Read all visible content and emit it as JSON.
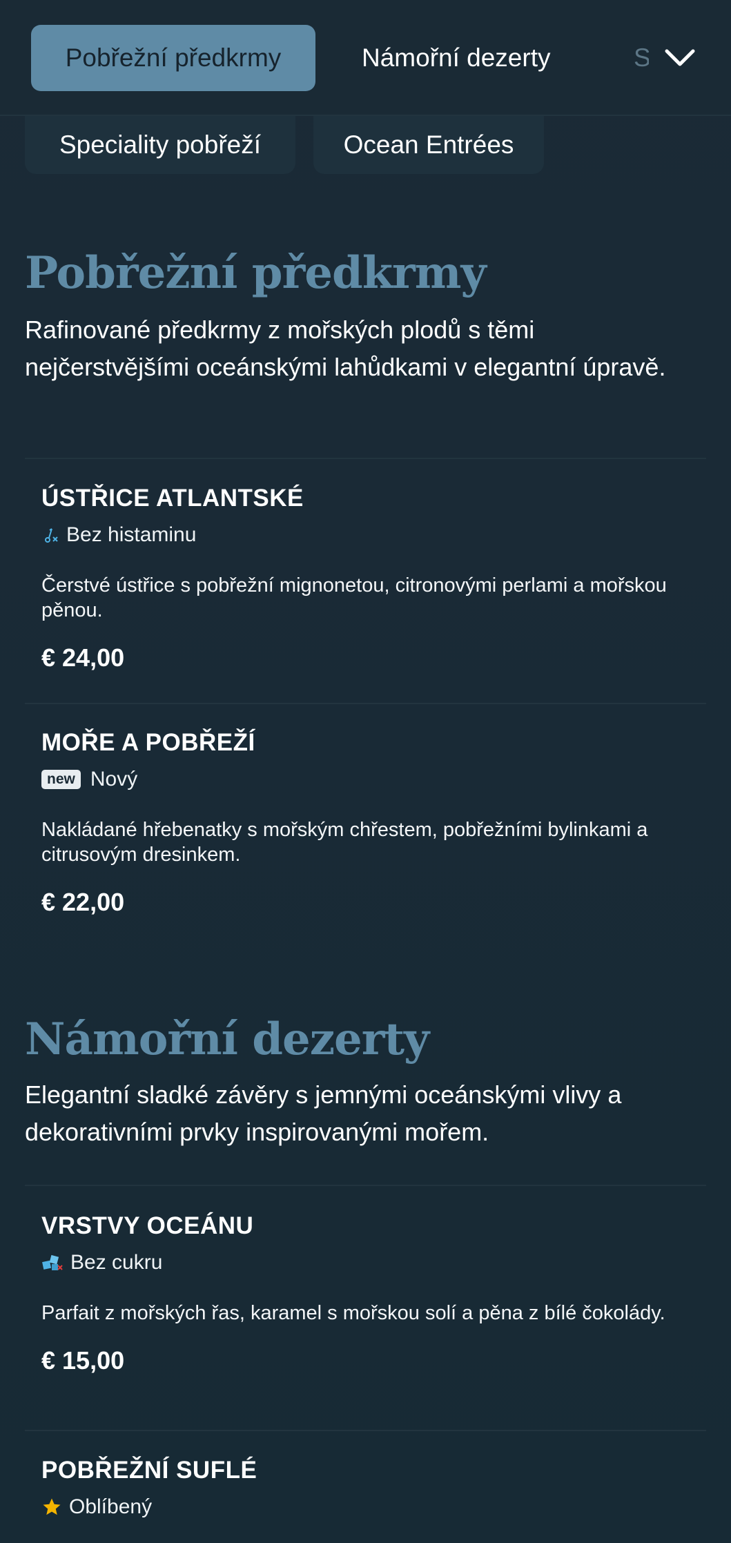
{
  "nav": {
    "tabs": [
      {
        "label": "Pobřežní předkrmy",
        "active": true
      },
      {
        "label": "Námořní dezerty",
        "active": false
      },
      {
        "label": "Speciality pobřeží",
        "active": false
      }
    ],
    "chips": [
      {
        "label": "Speciality pobřeží"
      },
      {
        "label": "Ocean Entrées"
      }
    ],
    "expand_icon": "chevron-down-icon"
  },
  "sections": [
    {
      "title": "Pobřežní předkrmy",
      "description": "Rafinované předkrmy z mořských plodů s těmi nejčerstvějšími oceánskými lahůdkami v elegantní úpravě.",
      "items": [
        {
          "name": "ÚSTŘICE ATLANTSKÉ",
          "tag": "Bez histaminu",
          "tag_icon": "histamine-free-icon",
          "description": "Čerstvé ústřice s pobřežní mignonetou, citronovými perlami a mořskou pěnou.",
          "price": "€ 24,00"
        },
        {
          "name": "MOŘE A POBŘEŽÍ",
          "badge": "new",
          "tag": "Nový",
          "description": "Nakládané hřebenatky s mořským chřestem, pobřežními bylinkami a citrusovým dresinkem.",
          "price": "€ 22,00"
        }
      ]
    },
    {
      "title": "Námořní dezerty",
      "description": "Elegantní sladké závěry s jemnými oceánskými vlivy a dekorativními prvky inspirovanými mořem.",
      "items": [
        {
          "name": "VRSTVY OCEÁNU",
          "tag": "Bez cukru",
          "tag_icon": "sugar-free-icon",
          "description": "Parfait z mořských řas, karamel s mořskou solí a pěna z bílé čokolády.",
          "price": "€ 15,00"
        },
        {
          "name": "POBŘEŽNÍ SUFLÉ",
          "tag": "Oblíbený",
          "tag_icon": "star-icon"
        }
      ]
    }
  ],
  "colors": {
    "background": "#1b2a36",
    "accent": "#5f8ba6",
    "icon_blue": "#4fb3e6",
    "star": "#f4b400"
  }
}
